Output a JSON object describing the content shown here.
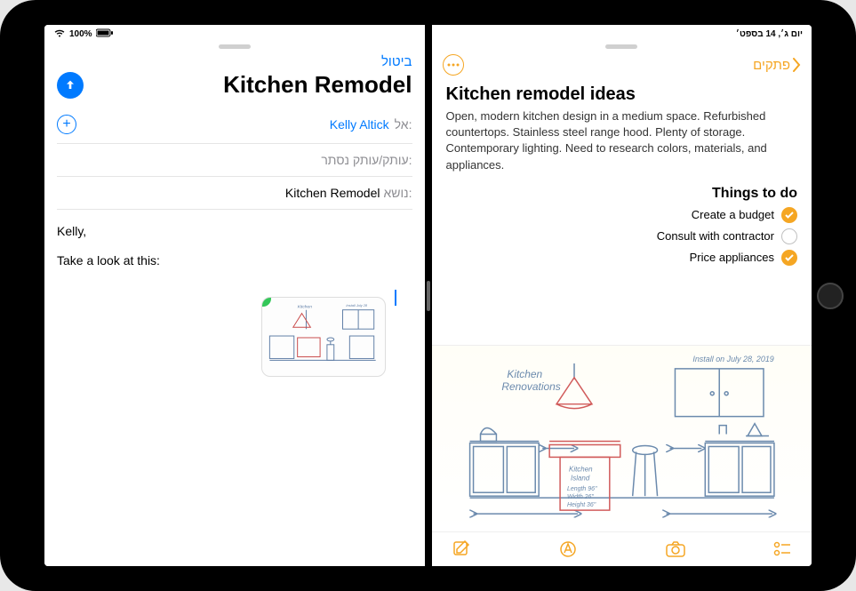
{
  "status": {
    "wifi": "100%",
    "date": "יום ג׳, 14 בספט׳"
  },
  "mail": {
    "cancel": "ביטול",
    "title": "Kitchen Remodel",
    "to_label": "אל:",
    "to_value": "Kelly Altick",
    "cc_label": "עותק/עותק נסתר:",
    "subject_label": "נושא:",
    "subject_value": "Kitchen Remodel",
    "body_line1": "Kelly,",
    "body_line2": "Take a look at this:"
  },
  "notes": {
    "back": "פתקים",
    "title": "Kitchen remodel ideas",
    "body": "Open, modern kitchen design in a medium space. Refurbished countertops. Stainless steel range hood. Plenty of storage. Contemporary lighting. Need to research colors, materials, and appliances.",
    "todo_heading": "Things to do",
    "todos": [
      {
        "label": "Create a budget",
        "checked": true
      },
      {
        "label": "Consult with contractor",
        "checked": false
      },
      {
        "label": "Price appliances",
        "checked": true
      }
    ],
    "sketch_title": "Kitchen Renovations",
    "sketch_note": "Install on July 28, 2019"
  },
  "colors": {
    "ios_blue": "#007aff",
    "notes_yellow": "#f5a623",
    "green": "#34c759"
  }
}
